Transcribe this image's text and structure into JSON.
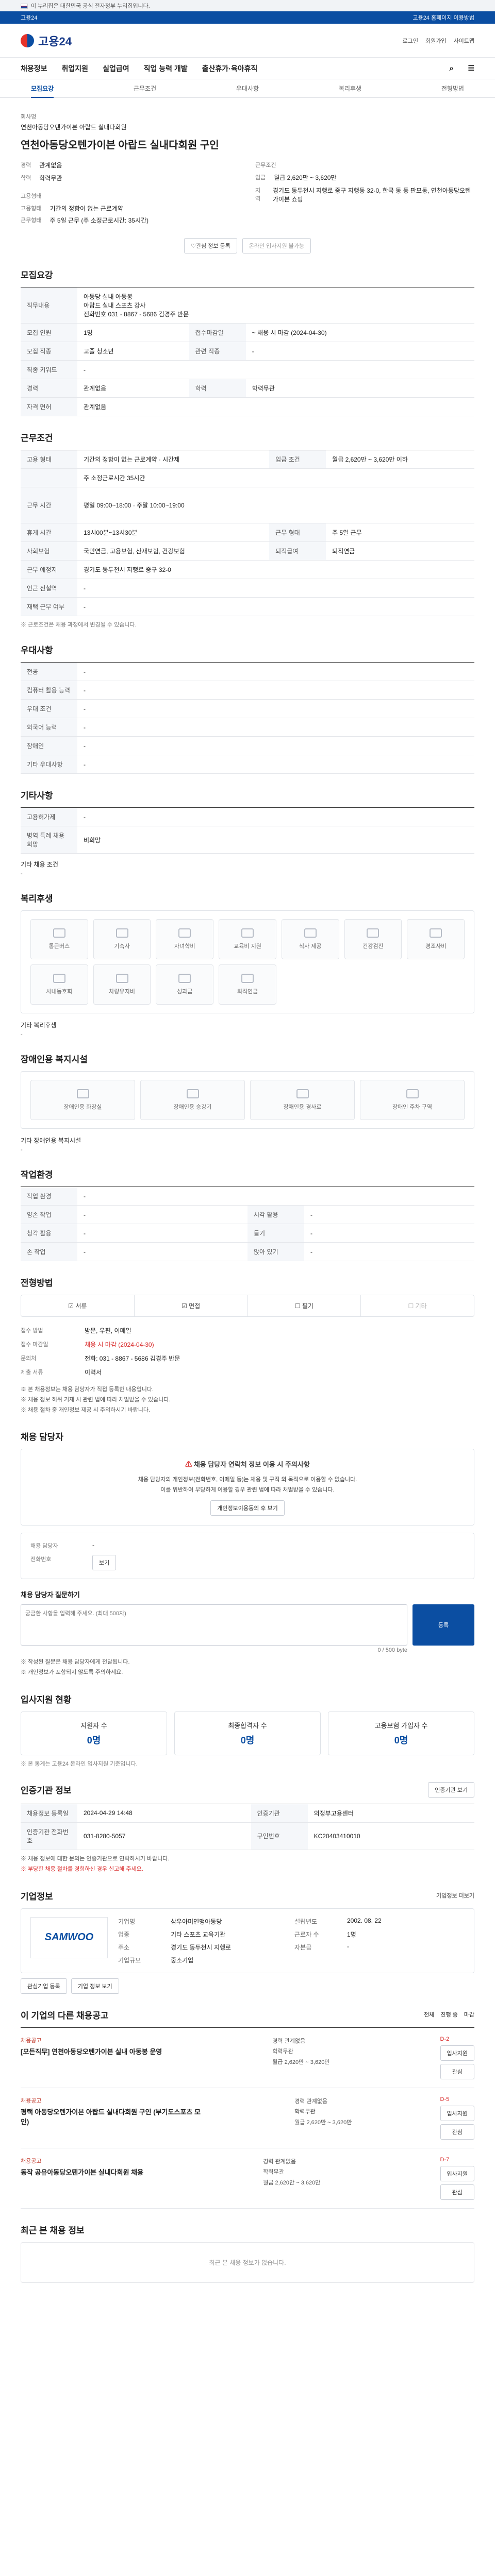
{
  "gov_banner": {
    "text": "이 누리집은 대한민국 공식 전자정부 누리집입니다.",
    "right": ""
  },
  "top_strip": {
    "left": "고용24",
    "right": "고용24 홈페이지 이용방법"
  },
  "header": {
    "logo": "고용24",
    "links": [
      "로그인",
      "회원가입",
      "사이트맵"
    ]
  },
  "gnb": [
    "채용정보",
    "취업지원",
    "실업급여",
    "직업 능력 개발",
    "출산휴가·육아휴직"
  ],
  "sub_tabs": [
    "모집요강",
    "근무조건",
    "우대사항",
    "복리후생",
    "전형방법"
  ],
  "job": {
    "company_label": "회사명",
    "company": "연천아동당오텐가이븐 아랍드 실내다회원",
    "title": "연천아동당오텐가이븐 아랍드 실내다회원 구인",
    "left": [
      [
        "경력",
        "관계없음"
      ],
      [
        "학력",
        "학력무관"
      ]
    ],
    "right_title": "근무조건",
    "right": [
      [
        "임금",
        "월급 2,620만 ~ 3,620만"
      ],
      [
        "지역",
        "경기도 동두천시 지행로 중구 지행동 32-0, 한국 동 동 판모동, 연천아동당오텐가이븐 쇼핑"
      ]
    ],
    "emp_title": "고용형태",
    "emp": [
      [
        "고용형태",
        "기간의 정함이 없는 근로계약"
      ],
      [
        "근무형태",
        "주 5일 근무 (주 소정근로시간: 35시간)"
      ]
    ],
    "btn_interest": "관심 정보 등록",
    "btn_apply": "온라인 입사지원 불가능"
  },
  "recruit": {
    "title": "모집요강",
    "duty_label": "직무내용",
    "duty_text": [
      "아동당 실내 아동봉",
      "아랍드 실내 스포츠 강사",
      "전화번호 031 - 8867 - 5686 김경주 반문"
    ],
    "rows": [
      [
        "모집 인원",
        "1명",
        "접수마감일",
        "~ 채용 시 마감 (2024-04-30)"
      ],
      [
        "모집 직종",
        "고졸 청소년",
        "관련 직종",
        "-"
      ],
      [
        "직종 키워드",
        "-",
        "",
        ""
      ],
      [
        "경력",
        "관계없음",
        "학력",
        "학력무관"
      ],
      [
        "자격 면허",
        "관계없음",
        "",
        ""
      ]
    ]
  },
  "work": {
    "title": "근무조건",
    "rows": [
      [
        "고용 형태",
        "기간의 정함이 없는 근로계약 · 시간제",
        "임금 조건",
        "월급 2,620만 ~ 3,620만 이하"
      ],
      [
        "",
        "주 소정근로시간 35시간",
        "",
        ""
      ],
      [
        "근무 시간",
        "평일 09:00~18:00 · 주말 10:00~19:00",
        "",
        ""
      ],
      [
        "휴게 시간",
        "13시00분~13시30분",
        "근무 형태",
        "주 5일 근무"
      ],
      [
        "사회보험",
        "국민연금, 고용보험, 산재보험, 건강보험",
        "퇴직급여",
        "퇴직연금"
      ],
      [
        "근무 예정지",
        "경기도 동두천시 지행로 중구 32-0",
        "",
        ""
      ],
      [
        "인근 전철역",
        "-",
        "",
        ""
      ],
      [
        "재택 근무 여부",
        "-",
        "",
        ""
      ]
    ],
    "note": "※ 근로조건은 채용 과정에서 변경될 수 있습니다."
  },
  "preference": {
    "title": "우대사항",
    "rows": [
      [
        "전공",
        "-"
      ],
      [
        "컴퓨터 활용 능력",
        "-"
      ],
      [
        "우대 조건",
        "-"
      ],
      [
        "외국어 능력",
        "-"
      ],
      [
        "장애인",
        "-"
      ],
      [
        "기타 우대사항",
        "-"
      ]
    ]
  },
  "other": {
    "title": "기타사항",
    "rows": [
      [
        "고용허가제",
        "-"
      ],
      [
        "병역 특례 채용 희망",
        "비희망"
      ]
    ],
    "extra_label": "기타 채용 조건",
    "extra_value": "-"
  },
  "welfare": {
    "title": "복리후생",
    "tiles": [
      "통근버스",
      "기숙사",
      "자녀학비",
      "교육비 지원",
      "식사 제공",
      "건강검진",
      "경조사비",
      "사내동호회",
      "차량유지비",
      "성과급",
      "퇴직연금"
    ],
    "note_label": "기타 복리후생",
    "note_value": "-"
  },
  "disability": {
    "title": "장애인용 복지시설",
    "tiles": [
      "장애인용 화장실",
      "장애인용 승강기",
      "장애인용 경사로",
      "장애인 주차 구역"
    ],
    "note_label": "기타 장애인용 복지시설",
    "note_value": "-"
  },
  "environment": {
    "title": "작업환경",
    "rows": [
      [
        "작업 환경",
        "-",
        "",
        ""
      ],
      [
        "양손 작업",
        "-",
        "시각 활용",
        "-"
      ],
      [
        "청각 활용",
        "-",
        "들기",
        "-"
      ],
      [
        "손 작업",
        "-",
        "앉아 있기",
        "-"
      ]
    ]
  },
  "selection": {
    "title": "전형방법",
    "tabs": [
      "서류",
      "면접",
      "필기",
      "기타"
    ],
    "method_label": "접수 방법",
    "method_value": "방문, 우편, 이메일",
    "contact_label": "문의처",
    "contact_value": "전화: 031 - 8867 - 5686 김경주 반문",
    "docs_label": "제출 서류",
    "docs_value": "이력서",
    "deadline_label": "접수 마감일",
    "deadline_value": "채용 시 마감 (2024-04-30)",
    "notes": [
      "※ 본 채용정보는 채용 담당자가 직접 등록한 내용입니다.",
      "※ 채용 정보 허위 기재 시 관련 법에 따라 처벌받을 수 있습니다.",
      "※ 채용 절차 중 개인정보 제공 시 주의하시기 바랍니다."
    ]
  },
  "contact": {
    "title": "채용 담당자",
    "warning": "채용 담당자 연락처 정보 이용 시 주의사항",
    "warning_body": "채용 담당자의 개인정보(전화번호, 이메일 등)는 채용 및 구직 외 목적으로 이용할 수 없습니다.",
    "warning_body2": "이를 위반하여 부당하게 이용할 경우 관련 법에 따라 처벌받을 수 있습니다.",
    "verify_btn": "개인정보이용동의 후 보기",
    "name_label": "채용 담당자",
    "phone_label": "전화번호",
    "phone_btn": "보기",
    "inquiry_title": "채용 담당자 질문하기",
    "inquiry_placeholder": "궁금한 사항을 입력해 주세요. (최대 500자)",
    "inquiry_count": "0 / 500 byte",
    "inquiry_submit": "등록",
    "inquiry_notes": [
      "※ 작성된 질문은 채용 담당자에게 전달됩니다.",
      "※ 개인정보가 포함되지 않도록 주의하세요."
    ]
  },
  "stats": {
    "title": "입사지원 현황",
    "items": [
      {
        "label": "지원자 수",
        "value": "0명"
      },
      {
        "label": "최종합격자 수",
        "value": "0명"
      },
      {
        "label": "고용보험 가입자 수",
        "value": "0명"
      }
    ],
    "note": "※ 본 통계는 고용24 온라인 입사지원 기준입니다."
  },
  "register": {
    "title": "인증기관 정보",
    "btn": "인증기관 보기",
    "rows": [
      [
        "채용정보 등록일",
        "2024-04-29 14:48",
        "인증기관",
        "의정부고용센터"
      ],
      [
        "인증기관 전화번호",
        "031-8280-5057",
        "구인번호",
        "KC20403410010"
      ]
    ],
    "notes": [
      "※ 채용 정보에 대한 문의는 인증기관으로 연락하시기 바랍니다.",
      "※ 부당한 채용 절차를 경험하신 경우 신고해 주세요."
    ]
  },
  "company_info": {
    "title": "기업정보",
    "more": "기업정보 더보기",
    "logo_text": "SAMWOO",
    "fields": [
      [
        "기업명",
        "삼우아미연맹아동당",
        "설립년도",
        "2002. 08. 22"
      ],
      [
        "업종",
        "기타 스포츠 교육기관",
        "근로자 수",
        "1명"
      ],
      [
        "주소",
        "경기도 동두천시 지행로",
        "자본금",
        "-"
      ],
      [
        "기업규모",
        "중소기업",
        "",
        ""
      ]
    ],
    "btns": [
      "관심기업 등록",
      "기업 정보 보기"
    ]
  },
  "similar": {
    "title": "이 기업의 다른 채용공고",
    "filters": [
      "전체",
      "진행 중",
      "마감"
    ],
    "items": [
      {
        "org": "채용공고",
        "title": "[모든직무] 연천아동당오텐가이븐 실내 아동봉 운영",
        "meta": [
          "경력 관계없음",
          "학력무관",
          "월급 2,620만 ~ 3,620만"
        ],
        "status": "D-2",
        "btn1": "입사지원",
        "btn2": "관심"
      },
      {
        "org": "채용공고",
        "title": "평택 아동당오텐가이븐 아랍드 실내다회원 구인 (부기도스포츠 모인)",
        "meta": [
          "경력 관계없음",
          "학력무관",
          "월급 2,620만 ~ 3,620만"
        ],
        "status": "D-5",
        "btn1": "입사지원",
        "btn2": "관심"
      },
      {
        "org": "채용공고",
        "title": "동작 공유아동당오텐가이븐 실내다회원 채용",
        "meta": [
          "경력 관계없음",
          "학력무관",
          "월급 2,620만 ~ 3,620만"
        ],
        "status": "D-7",
        "btn1": "입사지원",
        "btn2": "관심"
      }
    ]
  },
  "recent": {
    "title": "최근 본 채용 정보",
    "empty": "최근 본 채용 정보가 없습니다."
  }
}
